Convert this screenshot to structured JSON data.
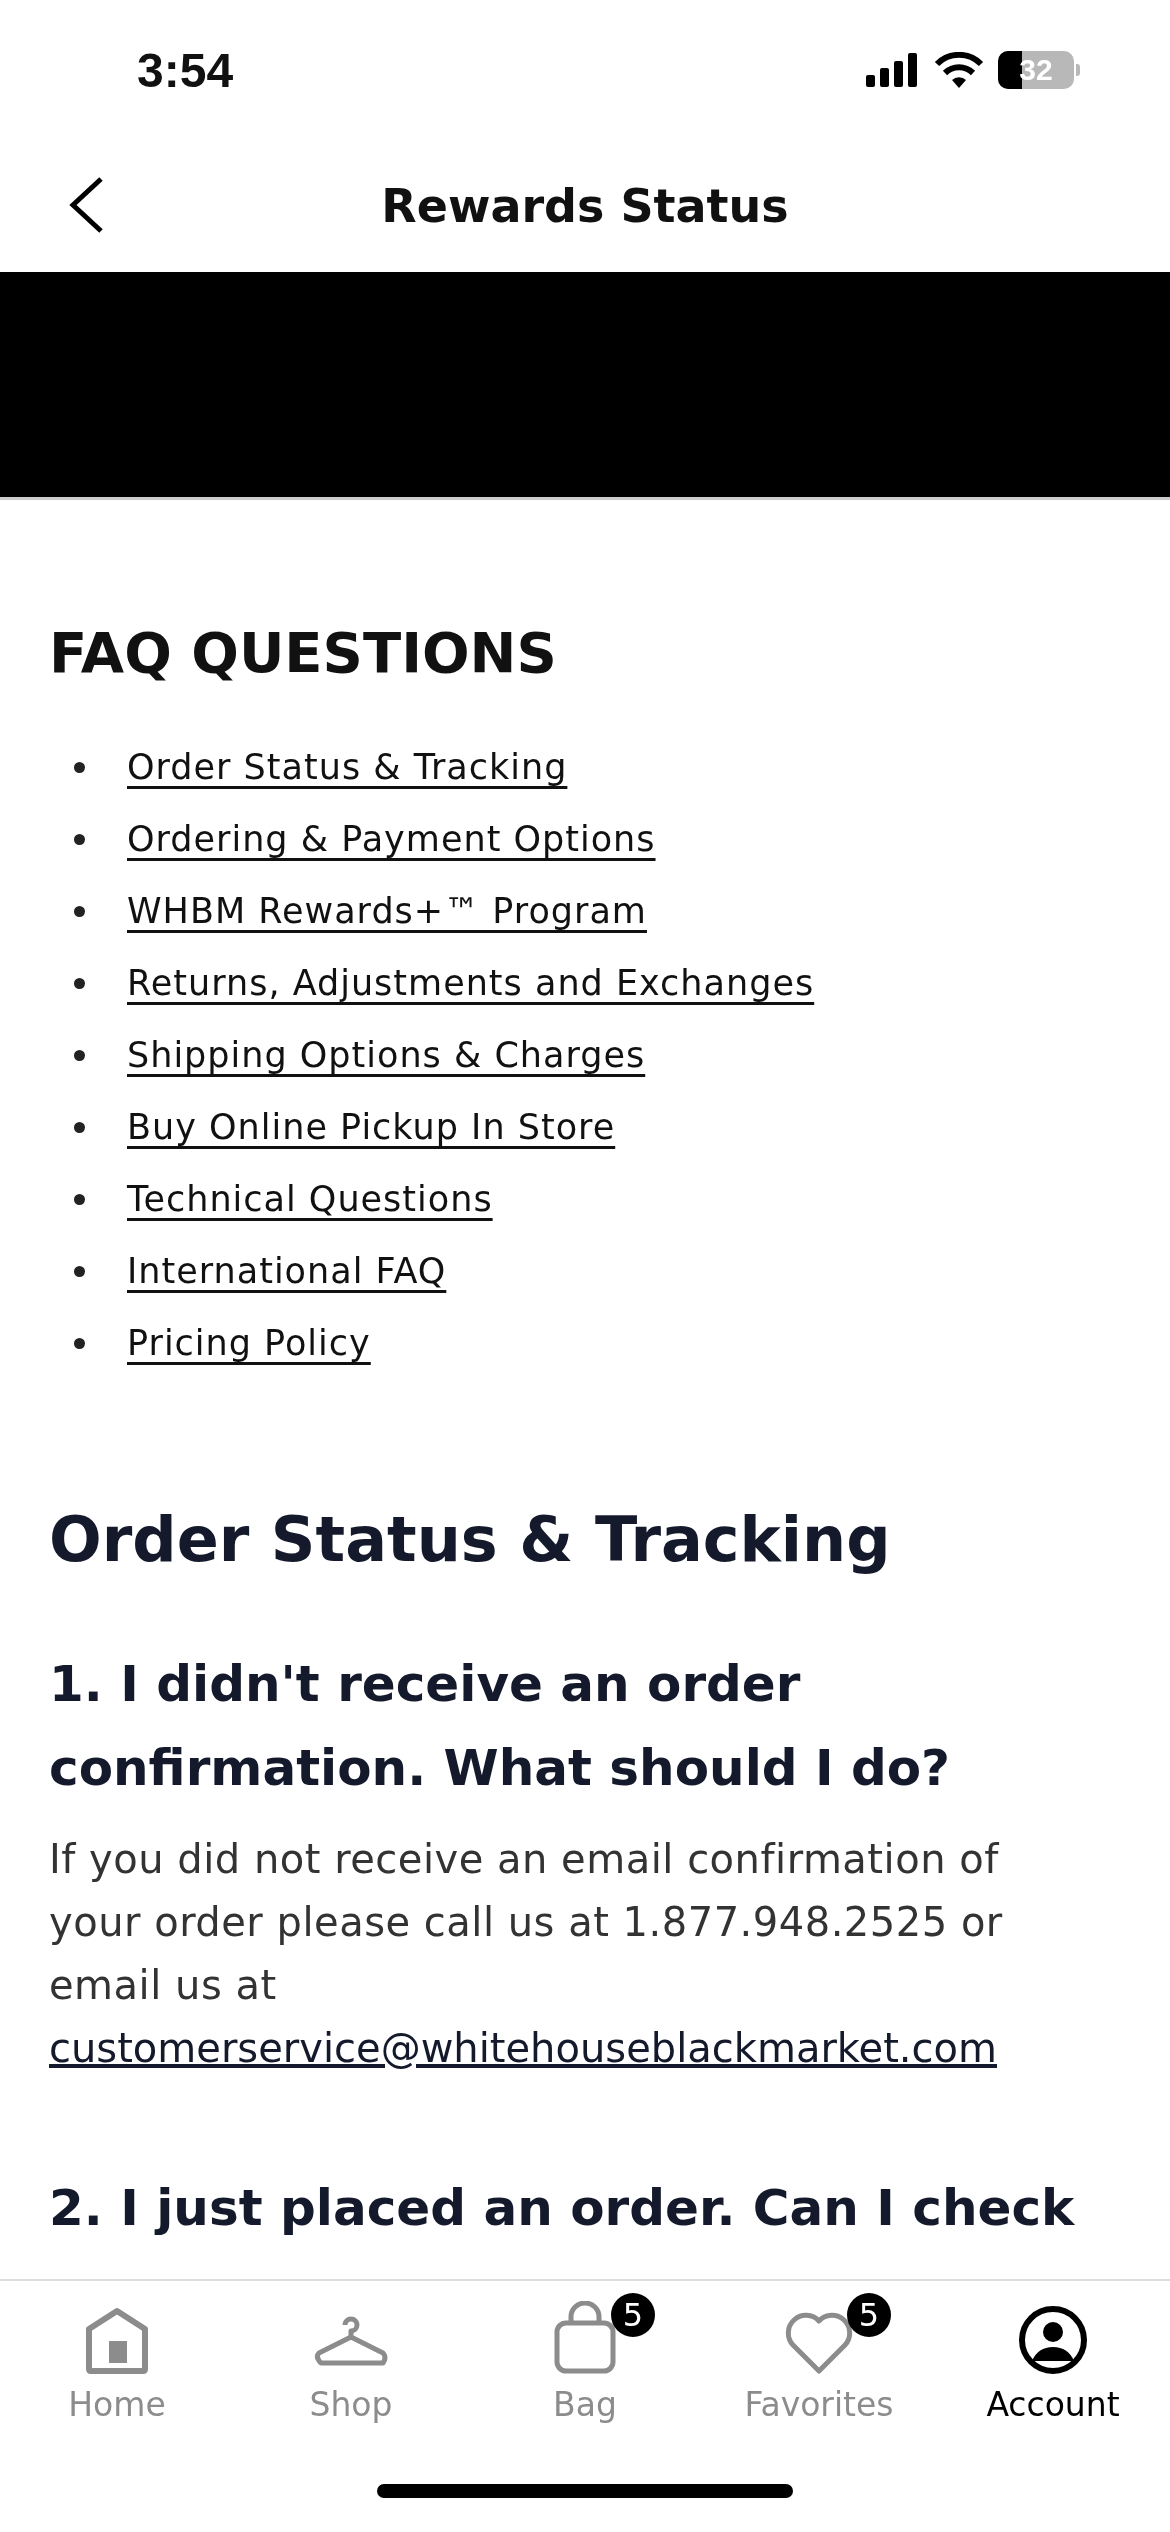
{
  "status_bar": {
    "time": "3:54",
    "battery": "32"
  },
  "header": {
    "title": "Rewards Status"
  },
  "faq": {
    "heading": "FAQ QUESTIONS",
    "links": [
      "Order Status & Tracking",
      "Ordering & Payment Options",
      "WHBM Rewards+™ Program",
      "Returns, Adjustments and Exchanges",
      "Shipping Options & Charges",
      "Buy Online Pickup In Store",
      "Technical Questions",
      "International FAQ",
      "Pricing Policy"
    ]
  },
  "section": {
    "heading": "Order Status & Tracking",
    "questions": [
      {
        "title": "1. I didn't receive an order confirmation. What should I do?",
        "body": "If you did not receive an email confirmation of your order please call us at 1.877.948.2525 or email us at",
        "link": "customerservice@whitehouseblackmarket.com"
      },
      {
        "title": "2. I just placed an order. Can I check"
      }
    ]
  },
  "tab_bar": [
    {
      "label": "Home",
      "selected": false
    },
    {
      "label": "Shop",
      "selected": false
    },
    {
      "label": "Bag",
      "selected": false,
      "badge": "5"
    },
    {
      "label": "Favorites",
      "selected": false,
      "badge": "5"
    },
    {
      "label": "Account",
      "selected": true
    }
  ]
}
